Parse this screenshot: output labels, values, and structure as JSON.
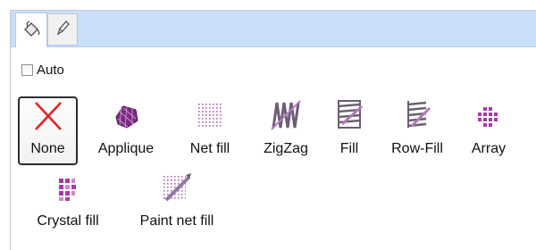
{
  "tabs": [
    {
      "name": "fill-tab",
      "icon": "paint-bucket-icon"
    },
    {
      "name": "pen-tab",
      "icon": "pen-icon"
    }
  ],
  "auto": {
    "label": "Auto",
    "checked": false
  },
  "options": [
    {
      "label": "None",
      "icon": "red-x-icon",
      "selected": true
    },
    {
      "label": "Applique",
      "icon": "applique-icon"
    },
    {
      "label": "Net fill",
      "icon": "net-fill-icon"
    },
    {
      "label": "ZigZag",
      "icon": "zigzag-icon"
    },
    {
      "label": "Fill",
      "icon": "fill-icon"
    },
    {
      "label": "Row-Fill",
      "icon": "row-fill-icon"
    },
    {
      "label": "Array",
      "icon": "array-icon"
    },
    {
      "label": "Crystal fill",
      "icon": "crystal-fill-icon"
    },
    {
      "label": "Paint net fill",
      "icon": "paint-net-fill-icon"
    }
  ],
  "colors": {
    "accent_purple": "#8a2f8f",
    "tab_strip": "#c9defa",
    "none_x": "#e22222"
  }
}
